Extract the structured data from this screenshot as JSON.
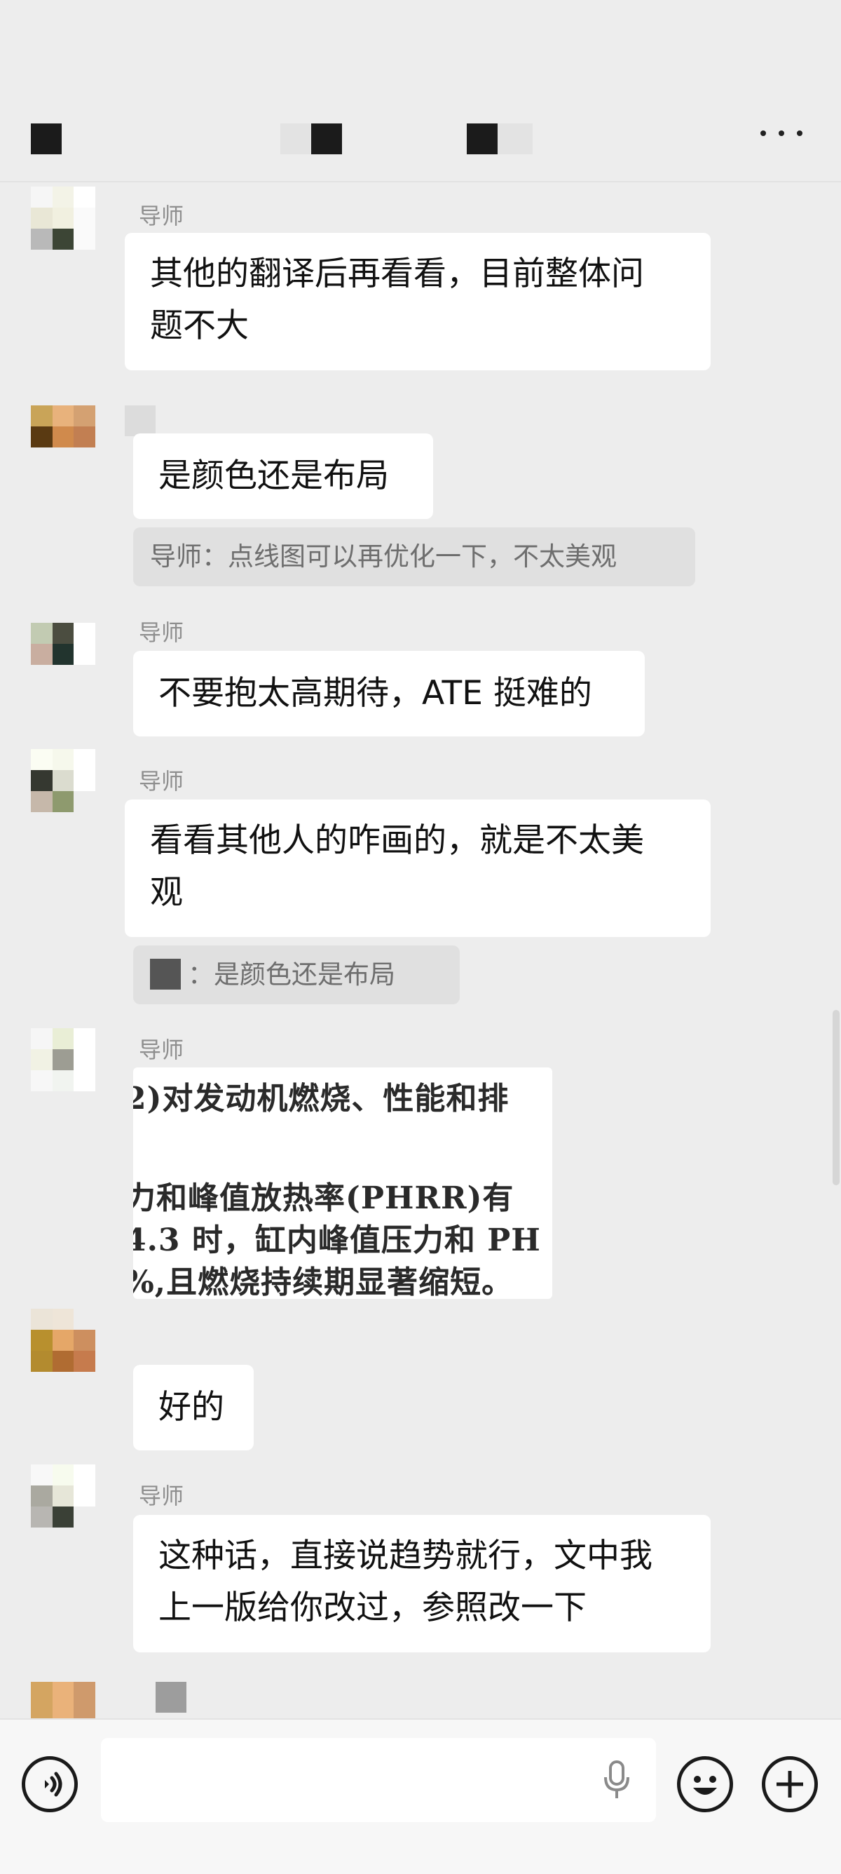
{
  "messages": {
    "m1": {
      "sender": "导师",
      "lines": [
        "其他的翻译后再看看，目前整体问",
        "题不大"
      ]
    },
    "m2": {
      "lines": [
        "是颜色还是布局"
      ],
      "quote": "导师：点线图可以再优化一下，不太美观"
    },
    "m3": {
      "sender": "导师",
      "lines": [
        "不要抱太高期待，ATE 挺难的"
      ]
    },
    "m4": {
      "sender": "导师",
      "lines": [
        "看看其他人的咋画的，就是不太美",
        "观"
      ],
      "quote": "：是颜色还是布局"
    },
    "m5": {
      "sender": "导师",
      "image_text": [
        "2)对发动机燃烧、性能和排",
        "力和峰值放热率(PHRR)有",
        "4.3 时，缸内峰值压力和 PH",
        "%,且燃烧持续期显著缩短。"
      ]
    },
    "m6": {
      "lines": [
        "好的"
      ]
    },
    "m7": {
      "sender": "导师",
      "lines": [
        "这种话，直接说趋势就行，文中我",
        "上一版给你改过，参照改一下"
      ]
    }
  },
  "icons": {
    "more": "more-dots-icon",
    "voice": "voice-icon",
    "mic": "mic-icon",
    "emoji": "emoji-icon",
    "plus": "plus-icon"
  },
  "colors": {
    "background": "#ededed",
    "bubble": "#ffffff",
    "quote": "#e0e0e0"
  }
}
